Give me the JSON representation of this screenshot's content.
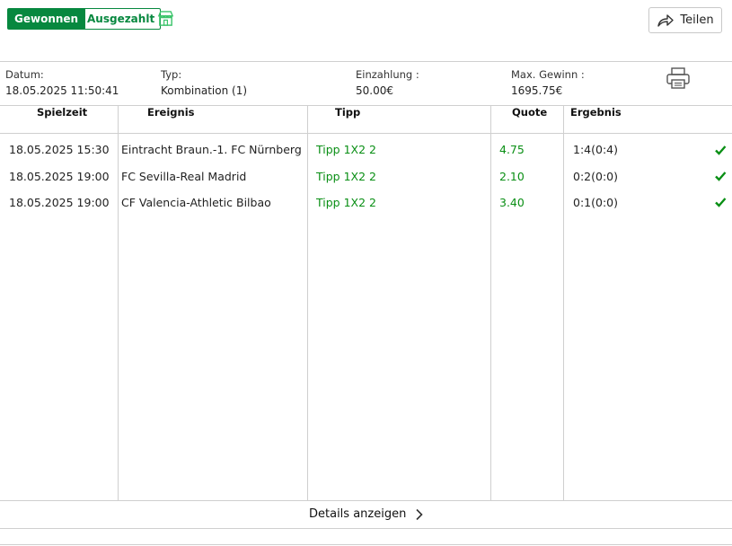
{
  "status": {
    "won_label": "Gewonnen",
    "paid_label": "Ausgezahlt"
  },
  "share_label": "Teilen",
  "bet_info": {
    "date_label": "Datum:",
    "date_value": "18.05.2025 11:50:41",
    "type_label": "Typ:",
    "type_value": "Kombination (1)",
    "stake_label": "Einzahlung :",
    "stake_value": "50.00€",
    "maxwin_label": "Max. Gewinn :",
    "maxwin_value": "1695.75€"
  },
  "table": {
    "headers": [
      "Spielzeit",
      "Ereignis",
      "Tipp",
      "Quote",
      "Ergebnis"
    ],
    "rows": [
      {
        "time": "18.05.2025 15:30",
        "event": "Eintracht Braun.-1. FC Nürnberg",
        "tip": "Tipp 1X2 2",
        "odds": "4.75",
        "result": "1:4(0:4)"
      },
      {
        "time": "18.05.2025 19:00",
        "event": "FC Sevilla-Real Madrid",
        "tip": "Tipp 1X2 2",
        "odds": "2.10",
        "result": "0:2(0:0)"
      },
      {
        "time": "18.05.2025 19:00",
        "event": "CF Valencia-Athletic Bilbao",
        "tip": "Tipp 1X2 2",
        "odds": "3.40",
        "result": "0:1(0:0)"
      }
    ]
  },
  "details_label": "Details anzeigen",
  "colors": {
    "accent_green": "#07883f",
    "tip_green": "#0a8f15",
    "border": "#cfcfcf"
  },
  "icons": [
    "shop-icon",
    "share-arrow-icon",
    "printer-icon",
    "check-icon",
    "chevron-right-icon"
  ]
}
